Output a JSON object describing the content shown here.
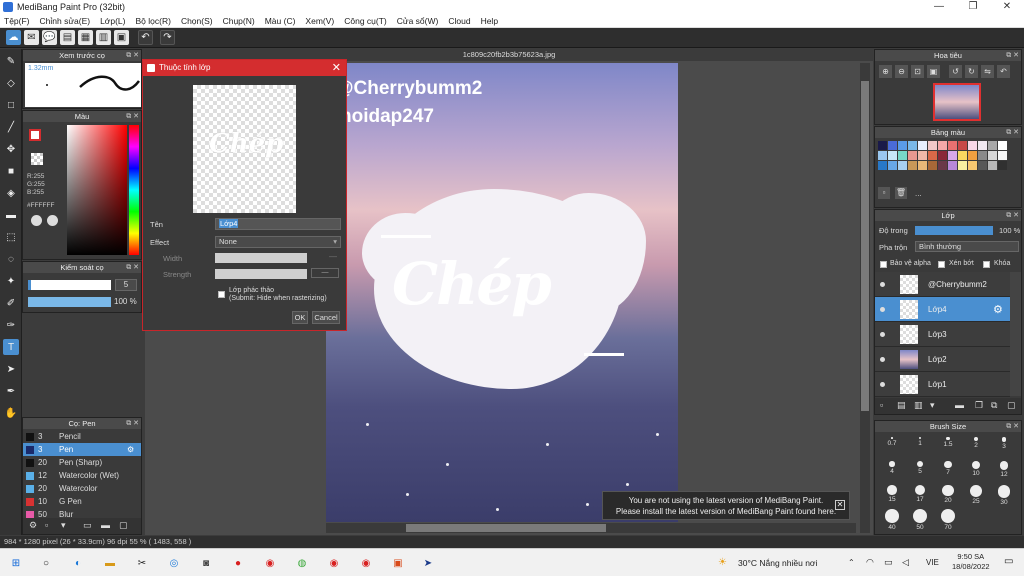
{
  "window": {
    "title": "MediBang Paint Pro (32bit)",
    "minimize": "—",
    "maximize": "❐",
    "close": "✕"
  },
  "menu": [
    "Tệp(F)",
    "Chỉnh sửa(E)",
    "Lớp(L)",
    "Bộ lọc(R)",
    "Chọn(S)",
    "Chụp(N)",
    "Màu (C)",
    "Xem(V)",
    "Công cụ(T)",
    "Cửa sổ(W)",
    "Cloud",
    "Help"
  ],
  "document": {
    "tab": "1c809c20fb2b3b75623a.jpg"
  },
  "preview_panel": {
    "title": "Xem trước cọ",
    "size": "1.32mm"
  },
  "color_panel": {
    "title": "Màu",
    "r": "R:255",
    "g": "G:255",
    "b": "B:255",
    "hex": "#FFFFFF"
  },
  "brush_control": {
    "title": "Kiểm soát cọ",
    "size_value": "5",
    "opacity_value": "100 %",
    "opacity": 1.0,
    "size_fill": 0.95
  },
  "brush_list": {
    "title": "Cọ: Pen",
    "items": [
      {
        "size": "3",
        "name": "Pencil",
        "color": "#111111"
      },
      {
        "size": "3",
        "name": "Pen",
        "color": "#1a2a6a",
        "selected": true
      },
      {
        "size": "20",
        "name": "Pen (Sharp)",
        "color": "#111111"
      },
      {
        "size": "12",
        "name": "Watercolor (Wet)",
        "color": "#5ab0e8"
      },
      {
        "size": "20",
        "name": "Watercolor",
        "color": "#5ab0e8"
      },
      {
        "size": "10",
        "name": "G Pen",
        "color": "#d83232"
      },
      {
        "size": "50",
        "name": "Blur",
        "color": "#e85aa8"
      }
    ]
  },
  "dialog": {
    "title": "Thuộc tính lớp",
    "preview_text": "Chép",
    "name_label": "Tên",
    "name_value": "Lớp4",
    "effect_label": "Effect",
    "effect_value": "None",
    "width_label": "Width",
    "strength_label": "Strength",
    "sketch_label": "Lớp phác thảo",
    "sketch_hint": "(Submit: Hide when rasterizing)",
    "ok": "OK",
    "cancel": "Cancel"
  },
  "artwork": {
    "watermark1": "@Cherrybumm2",
    "watermark2": "hoidap247",
    "title_text": "Chép"
  },
  "navigator": {
    "title": "Hoa tiêu"
  },
  "palette": {
    "title": "Bảng màu",
    "colors": [
      "#1a1a4a",
      "#4a6bd8",
      "#5a9be8",
      "#7ab8e8",
      "#e8f0ff",
      "#f0c8c8",
      "#f4a8a8",
      "#e87070",
      "#c84848",
      "#f8d8e8",
      "#f0e8f0",
      "#a8a8a8",
      "#ffffff",
      "#9ac8f0",
      "#c8e8f8",
      "#78d8c8",
      "#e89890",
      "#f0b8a8",
      "#d86848",
      "#8a2838",
      "#d8a8e8",
      "#f8d860",
      "#f0a040",
      "#8a8a8a",
      "#d8d8d8",
      "#f8f8f8",
      "#2878c8",
      "#68a8e8",
      "#a8d0f0",
      "#c89858",
      "#e8b878",
      "#a86838",
      "#6a3848",
      "#b888d8",
      "#f8f0a0",
      "#f8c870",
      "#585858",
      "#b8b8b8",
      "#303030"
    ],
    "more": "..."
  },
  "layers": {
    "title": "Lớp",
    "opacity_label": "Độ trong",
    "opacity_value": "100 %",
    "blend_label": "Pha trộn",
    "blend_value": "Bình thường",
    "protect_alpha": "Bảo vệ alpha",
    "clipping": "Xén bớt",
    "lock": "Khóa",
    "items": [
      {
        "name": "@Cherrybumm2",
        "selected": false
      },
      {
        "name": "Lớp4",
        "selected": true
      },
      {
        "name": "Lớp3",
        "selected": false
      },
      {
        "name": "Lớp2",
        "selected": false
      },
      {
        "name": "Lớp1",
        "selected": false
      }
    ]
  },
  "brush_size": {
    "title": "Brush Size",
    "sizes": [
      "0.7",
      "1",
      "1.5",
      "2",
      "3",
      "4",
      "5",
      "7",
      "10",
      "12",
      "15",
      "17",
      "20",
      "25",
      "30",
      "40",
      "50",
      "70"
    ]
  },
  "notice": {
    "line1": "You are not using the latest version of MediBang Paint.",
    "line2": "Please install the latest version of MediBang Paint found here."
  },
  "status": {
    "text": "984 * 1280 pixel  (26 * 33.9cm)  96 dpi  55 %  ( 1483, 558 )"
  },
  "taskbar": {
    "weather": "30°C  Nắng nhiều nơi",
    "lang": "VIE",
    "time": "9:50 SA",
    "date": "18/08/2022"
  }
}
